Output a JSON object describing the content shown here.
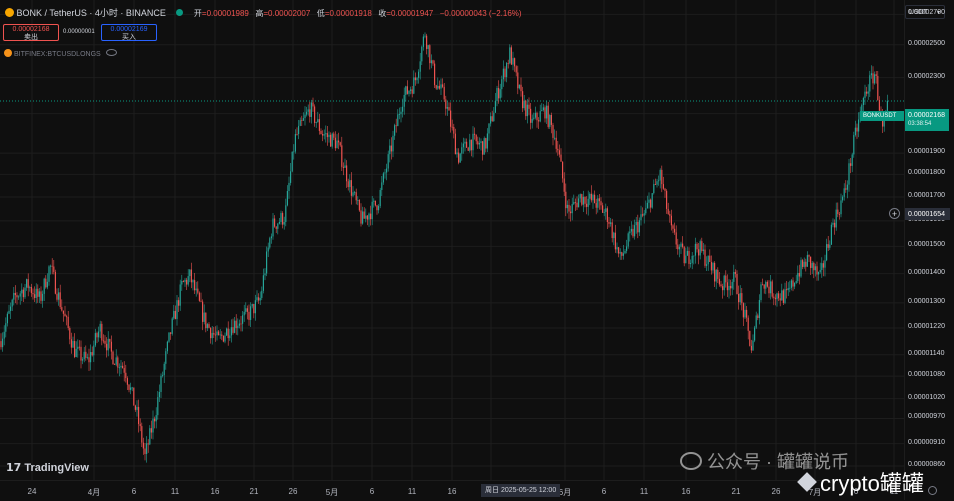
{
  "header": {
    "symbol": "BONK / TetherUS · 4小时 · BINANCE",
    "open_label": "开",
    "open_value": "=0.00001989",
    "high_label": "高",
    "high_value": "=0.00002007",
    "low_label": "低",
    "low_value": "=0.00001918",
    "close_label": "收",
    "close_value": "=0.00001947",
    "change": "−0.00000043 (−2.16%)"
  },
  "trade": {
    "sell_price": "0.00002168",
    "sell_label": "卖出",
    "spread": "0.00000001",
    "buy_price": "0.00002169",
    "buy_label": "买入"
  },
  "indicator": {
    "label": "BITFINEX:BTCUSDLONGS"
  },
  "currency_button": {
    "label": "USDT"
  },
  "y_axis_labels": [
    "0.00002700",
    "0.00002500",
    "0.00002300",
    "0.00002100",
    "0.00001900",
    "0.00001800",
    "0.00001700",
    "0.00001600",
    "0.00001500",
    "0.00001400",
    "0.00001300",
    "0.00001220",
    "0.00001140",
    "0.00001080",
    "0.00001020",
    "0.00000970",
    "0.00000910",
    "0.00000860"
  ],
  "price_tag": {
    "symbol": "BONKUSDT",
    "price": "0.00002168",
    "countdown": "03:38:54"
  },
  "crosshair_price": {
    "value": "0.00001654"
  },
  "x_axis_labels": [
    "24",
    "4月",
    "6",
    "11",
    "16",
    "21",
    "26",
    "5月",
    "6",
    "11",
    "16",
    "21",
    "6月",
    "6",
    "11",
    "16",
    "21",
    "26",
    "7月",
    "6",
    "11"
  ],
  "x_crosshair_label": "周日 2025-05-25  12:00",
  "branding": {
    "logo_text": "TradingView"
  },
  "watermark": {
    "text": "公众号 · 罐罐说币",
    "overlay": "crypto罐罐"
  },
  "colors": {
    "background": "#0f0f0f",
    "up": "#26a69a",
    "down": "#ef5350",
    "price_tag": "#089981",
    "gridline": "#1d1d1d",
    "change": "#ef5350"
  },
  "chart_data": {
    "type": "candlestick",
    "timeframe": "4小时",
    "y_scale": "log",
    "y_range": [
      8.3e-06,
      2.8e-05
    ],
    "last_price": 2.168e-05,
    "crosshair_price": 1.654e-05,
    "path": [
      [
        0,
        1.18e-05
      ],
      [
        15,
        1.32e-05
      ],
      [
        28,
        1.36e-05
      ],
      [
        40,
        1.31e-05
      ],
      [
        50,
        1.43e-05
      ],
      [
        62,
        1.28e-05
      ],
      [
        75,
        1.15e-05
      ],
      [
        88,
        1.12e-05
      ],
      [
        100,
        1.22e-05
      ],
      [
        112,
        1.14e-05
      ],
      [
        125,
        1.1e-05
      ],
      [
        137,
        9.8e-06
      ],
      [
        145,
        8.8e-06
      ],
      [
        155,
        9.8e-06
      ],
      [
        170,
        1.2e-05
      ],
      [
        182,
        1.36e-05
      ],
      [
        190,
        1.39e-05
      ],
      [
        205,
        1.24e-05
      ],
      [
        218,
        1.18e-05
      ],
      [
        232,
        1.23e-05
      ],
      [
        248,
        1.26e-05
      ],
      [
        260,
        1.31e-05
      ],
      [
        272,
        1.58e-05
      ],
      [
        285,
        1.62e-05
      ],
      [
        295,
        1.97e-05
      ],
      [
        310,
        2.13e-05
      ],
      [
        322,
        2e-05
      ],
      [
        337,
        1.95e-05
      ],
      [
        350,
        1.75e-05
      ],
      [
        362,
        1.6e-05
      ],
      [
        378,
        1.68e-05
      ],
      [
        390,
        1.9e-05
      ],
      [
        402,
        2.18e-05
      ],
      [
        415,
        2.28e-05
      ],
      [
        425,
        2.58e-05
      ],
      [
        435,
        2.28e-05
      ],
      [
        445,
        2.18e-05
      ],
      [
        458,
        1.88e-05
      ],
      [
        470,
        1.96e-05
      ],
      [
        485,
        1.93e-05
      ],
      [
        497,
        2.2e-05
      ],
      [
        510,
        2.45e-05
      ],
      [
        520,
        2.2e-05
      ],
      [
        532,
        2.05e-05
      ],
      [
        545,
        2.12e-05
      ],
      [
        557,
        1.95e-05
      ],
      [
        568,
        1.63e-05
      ],
      [
        580,
        1.7e-05
      ],
      [
        595,
        1.68e-05
      ],
      [
        608,
        1.62e-05
      ],
      [
        620,
        1.45e-05
      ],
      [
        632,
        1.55e-05
      ],
      [
        645,
        1.63e-05
      ],
      [
        660,
        1.8e-05
      ],
      [
        672,
        1.55e-05
      ],
      [
        685,
        1.45e-05
      ],
      [
        698,
        1.5e-05
      ],
      [
        710,
        1.43e-05
      ],
      [
        722,
        1.36e-05
      ],
      [
        735,
        1.38e-05
      ],
      [
        745,
        1.25e-05
      ],
      [
        752,
        1.15e-05
      ],
      [
        762,
        1.38e-05
      ],
      [
        775,
        1.33e-05
      ],
      [
        787,
        1.32e-05
      ],
      [
        797,
        1.4e-05
      ],
      [
        808,
        1.45e-05
      ],
      [
        820,
        1.38e-05
      ],
      [
        832,
        1.58e-05
      ],
      [
        845,
        1.72e-05
      ],
      [
        855,
        1.98e-05
      ],
      [
        866,
        2.23e-05
      ],
      [
        875,
        2.33e-05
      ],
      [
        883,
        2e-05
      ],
      [
        888,
        2.14e-05
      ]
    ]
  }
}
